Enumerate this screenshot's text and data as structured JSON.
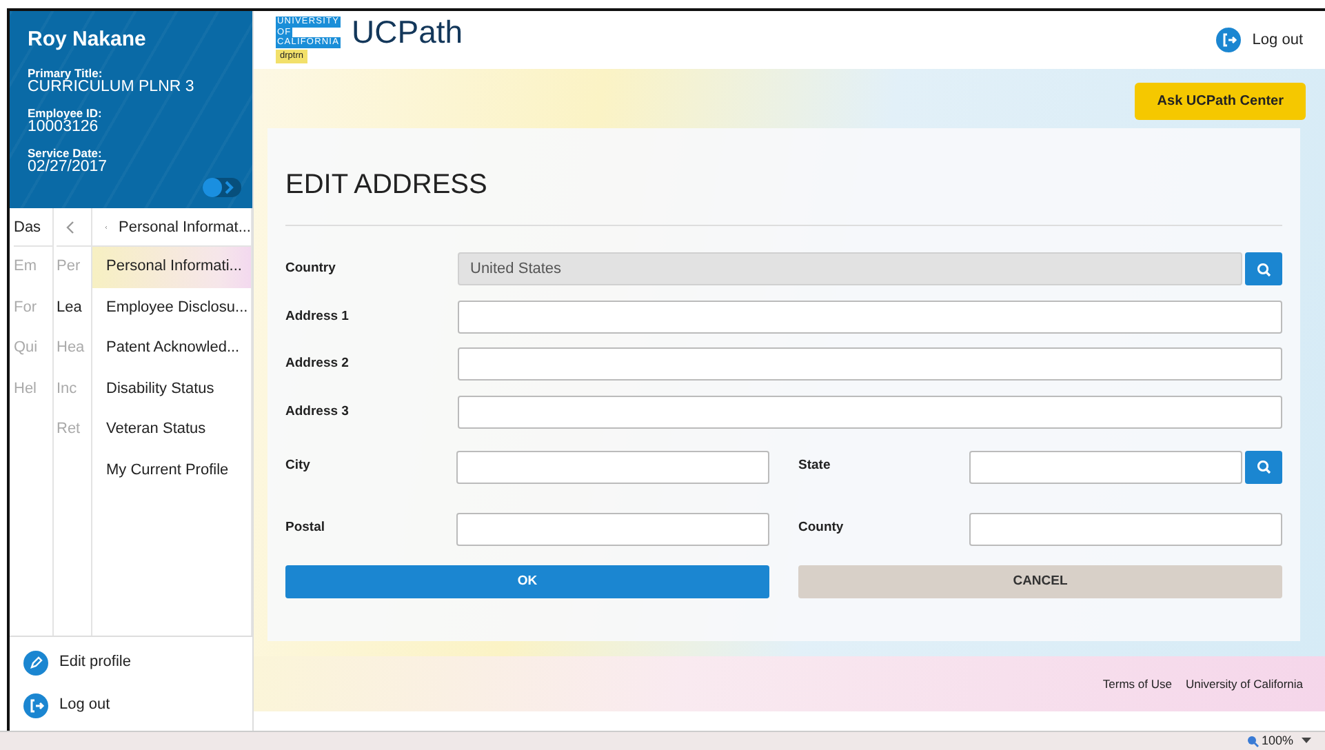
{
  "profile": {
    "name": "Roy Nakane",
    "fields": [
      {
        "label": "Primary Title:",
        "value": "CURRICULUM PLNR 3"
      },
      {
        "label": "Employee ID:",
        "value": "10003126"
      },
      {
        "label": "Service Date:",
        "value": "02/27/2017"
      }
    ]
  },
  "nav": {
    "column_1": {
      "header": "Das",
      "items": [
        "Em",
        "For",
        "Qui",
        "Hel"
      ]
    },
    "column_2": [
      {
        "label": "Per",
        "selected": false
      },
      {
        "label": "Lea",
        "selected": true
      },
      {
        "label": "Hea",
        "selected": false
      },
      {
        "label": "Inc",
        "selected": false
      },
      {
        "label": "Ret",
        "selected": false
      }
    ],
    "column_3": {
      "back_label": "Personal Informat...",
      "items": [
        {
          "label": "Personal Informati...",
          "selected": true
        },
        {
          "label": "Employee Disclosu...",
          "selected": false
        },
        {
          "label": "Patent Acknowled...",
          "selected": false
        },
        {
          "label": "Disability Status",
          "selected": false
        },
        {
          "label": "Veteran Status",
          "selected": false
        },
        {
          "label": "My Current Profile",
          "selected": false
        }
      ]
    }
  },
  "sidebar_actions": [
    {
      "kind": "edit",
      "label": "Edit profile"
    },
    {
      "kind": "logout",
      "label": "Log out"
    }
  ],
  "header": {
    "logo_lines": [
      "UNIVERSITY",
      "OF",
      "CALIFORNIA"
    ],
    "env_tag": "drptrn",
    "app_name": "UCPath",
    "logout": "Log out"
  },
  "ask_button": "Ask UCPath Center",
  "form": {
    "title": "EDIT ADDRESS",
    "rows": [
      {
        "fields": [
          {
            "label": "Country",
            "value": "United States",
            "disabled": true,
            "kind": "lookup"
          }
        ]
      },
      {
        "fields": [
          {
            "label": "Address 1",
            "disabled": false,
            "kind": "text"
          }
        ]
      },
      {
        "fields": [
          {
            "label": "Address 2",
            "disabled": false,
            "kind": "text"
          }
        ]
      },
      {
        "fields": [
          {
            "label": "Address 3",
            "disabled": false,
            "kind": "text"
          }
        ]
      },
      {
        "fields": [
          {
            "label": "City",
            "disabled": false,
            "kind": "text"
          },
          {
            "label": "State",
            "disabled": false,
            "kind": "lookup"
          }
        ]
      },
      {
        "fields": [
          {
            "label": "Postal",
            "disabled": false,
            "kind": "text"
          },
          {
            "label": "County",
            "disabled": false,
            "kind": "text"
          }
        ]
      }
    ],
    "buttons": [
      {
        "kind": "primary",
        "label": "OK"
      },
      {
        "kind": "secondary",
        "label": "CANCEL"
      }
    ]
  },
  "footer_links": [
    "Terms of Use",
    "University of California"
  ],
  "status_bar": {
    "zoom": "100%"
  }
}
